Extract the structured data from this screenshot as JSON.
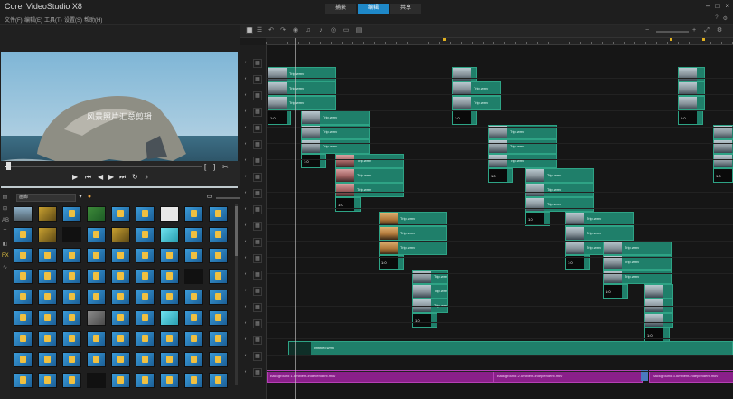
{
  "app": {
    "title": "Corel VideoStudio X8"
  },
  "mode_tabs": [
    {
      "label": "捕获",
      "active": false
    },
    {
      "label": "编辑",
      "active": true
    },
    {
      "label": "共享",
      "active": false
    }
  ],
  "menu": [
    {
      "label": "文件(F)"
    },
    {
      "label": "编辑(E)"
    },
    {
      "label": "工具(T)"
    },
    {
      "label": "设置(S)"
    },
    {
      "label": "帮助(H)"
    }
  ],
  "preview": {
    "overlay_text": "风景照片汇总剪辑",
    "scrub_position": 0.02
  },
  "library": {
    "selected_category": "画廊",
    "scroll_position": 0.05
  },
  "accent_colors": {
    "active_tab": "#1e88c8",
    "video_clip": "#1f7f6a",
    "music_clip": "#8a1f8a",
    "marker": "#e0b020"
  },
  "icons": {
    "toolbar": [
      "storyboard-view-icon",
      "timeline-view-icon",
      "undo-icon",
      "redo-icon",
      "record-icon",
      "sound-mixer-icon",
      "auto-music-icon",
      "motion-tracking-icon",
      "subtitle-icon",
      "multicam-icon"
    ],
    "player": [
      "play-icon",
      "home-icon",
      "prev-frame-icon",
      "next-frame-icon",
      "end-icon",
      "repeat-icon",
      "volume-icon"
    ],
    "library_sidebar": [
      "media-icon",
      "instant-project-icon",
      "transition-icon",
      "title-icon",
      "graphic-icon",
      "filter-icon",
      "path-icon"
    ]
  },
  "clips": {
    "row0": [
      {
        "label": "Trip.wmv",
        "time": ""
      },
      {
        "label": "Trip.wmv",
        "time": ""
      },
      {
        "label": "Trip.wmv",
        "time": ""
      }
    ],
    "row1": [
      {
        "label": "Trip.wmv",
        "time": ""
      },
      {
        "label": "Trip.wmv",
        "time": ""
      },
      {
        "label": "Trip.wmv",
        "time": ""
      }
    ],
    "row2": [
      {
        "label": "Trip.wmv",
        "time": "1:0"
      },
      {
        "label": "Trip.wmv",
        "time": ""
      },
      {
        "label": "Trip.wmv",
        "time": ""
      }
    ],
    "row3": [
      {
        "label": "Trip.wmv",
        "time": ""
      },
      {
        "label": "Trip.wmv",
        "time": "1:0"
      },
      {
        "label": "Trip.wmv",
        "time": ""
      }
    ]
  },
  "title_track": {
    "label": "Untitled.wmv"
  },
  "music_track": [
    {
      "label": "Background 1 Ambient-independent.mov"
    },
    {
      "label": "Background 2 Ambient-independent.mov"
    },
    {
      "label": "Background 3 Ambient-independent.mov"
    }
  ]
}
